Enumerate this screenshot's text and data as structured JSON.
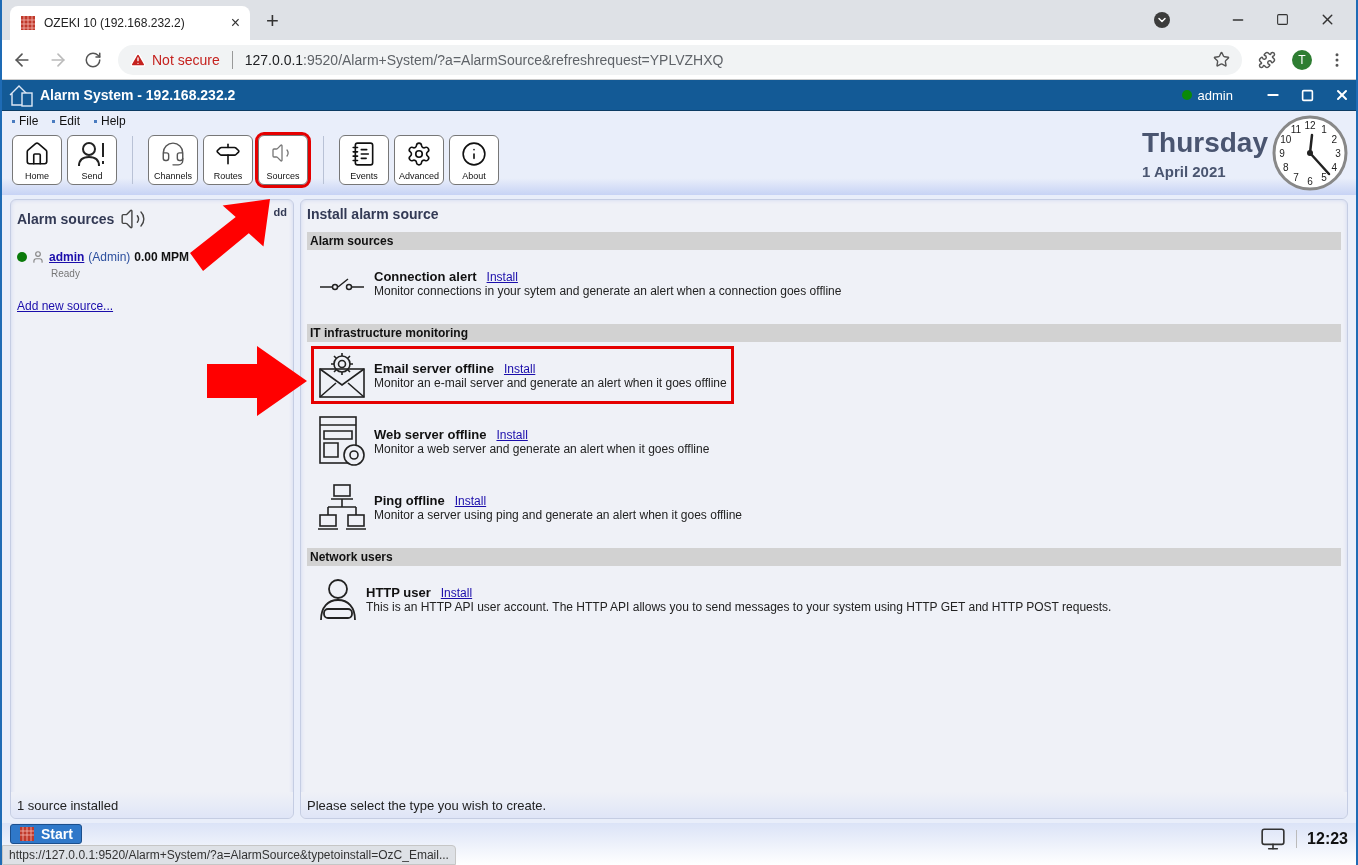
{
  "browser": {
    "tab": {
      "title": "OZEKI 10 (192.168.232.2)",
      "close": "×"
    },
    "new_tab": "+",
    "security": "Not secure",
    "url_host": "127.0.0.1",
    "url_rest": ":9520/Alarm+System/?a=AlarmSource&refreshrequest=YPLVZHXQ",
    "profile": "T"
  },
  "app": {
    "title": "Alarm System - 192.168.232.2",
    "user": "admin",
    "user_online": true
  },
  "menu": [
    "File",
    "Edit",
    "Help"
  ],
  "toolbar": [
    [
      {
        "label": "Home",
        "kind": "home",
        "highlighted": false
      },
      {
        "label": "Send",
        "kind": "send",
        "highlighted": false
      }
    ],
    [
      {
        "label": "Channels",
        "kind": "channels",
        "highlighted": false
      },
      {
        "label": "Routes",
        "kind": "routes",
        "highlighted": false
      },
      {
        "label": "Sources",
        "kind": "sources",
        "highlighted": true
      }
    ],
    [
      {
        "label": "Events",
        "kind": "events",
        "highlighted": false
      },
      {
        "label": "Advanced",
        "kind": "advanced",
        "highlighted": false
      },
      {
        "label": "About",
        "kind": "about",
        "highlighted": false
      }
    ]
  ],
  "date": {
    "day": "Thursday",
    "date": "1 April 2021"
  },
  "clock": {
    "numerals": [
      "11",
      "12",
      "1",
      "10",
      "2",
      "9",
      "3",
      "8",
      "4",
      "7",
      "5",
      "6"
    ]
  },
  "left_panel": {
    "title": "Alarm sources",
    "add_label": "dd",
    "sources": [
      {
        "name": "admin",
        "role": "(Admin)",
        "rate": "0.00 MPM",
        "status": "Ready",
        "online": true
      }
    ],
    "add_link": "Add new source...",
    "footer": "1 source installed"
  },
  "right_panel": {
    "title": "Install alarm source",
    "sections": [
      {
        "title": "Alarm sources",
        "items": [
          {
            "kind": "switch",
            "name": "Connection alert",
            "action": "Install",
            "description": "Monitor connections in your sytem and generate an alert when a connection goes offline",
            "highlighted": false
          }
        ]
      },
      {
        "title": "IT infrastructure monitoring",
        "items": [
          {
            "kind": "email",
            "name": "Email server offline",
            "action": "Install",
            "description": "Monitor an e-mail server and generate an alert when it goes offline",
            "highlighted": true
          },
          {
            "kind": "web",
            "name": "Web server offline",
            "action": "Install",
            "description": "Monitor a web server and generate an alert when it goes offline",
            "highlighted": false
          },
          {
            "kind": "ping",
            "name": "Ping offline",
            "action": "Install",
            "description": "Monitor a server using ping and generate an alert when it goes offline",
            "highlighted": false
          }
        ]
      },
      {
        "title": "Network users",
        "items": [
          {
            "kind": "user",
            "name": "HTTP user",
            "action": "Install",
            "description": "This is an HTTP API user account. The HTTP API allows you to send messages to your system using HTTP GET and HTTP POST requests.",
            "highlighted": false
          }
        ]
      }
    ],
    "footer": "Please select the type you wish to create."
  },
  "taskbar": {
    "start": "Start",
    "time": "12:23",
    "status_url": "https://127.0.0.1:9520/Alarm+System/?a=AlarmSource&typetoinstall=OzC_Email..."
  }
}
